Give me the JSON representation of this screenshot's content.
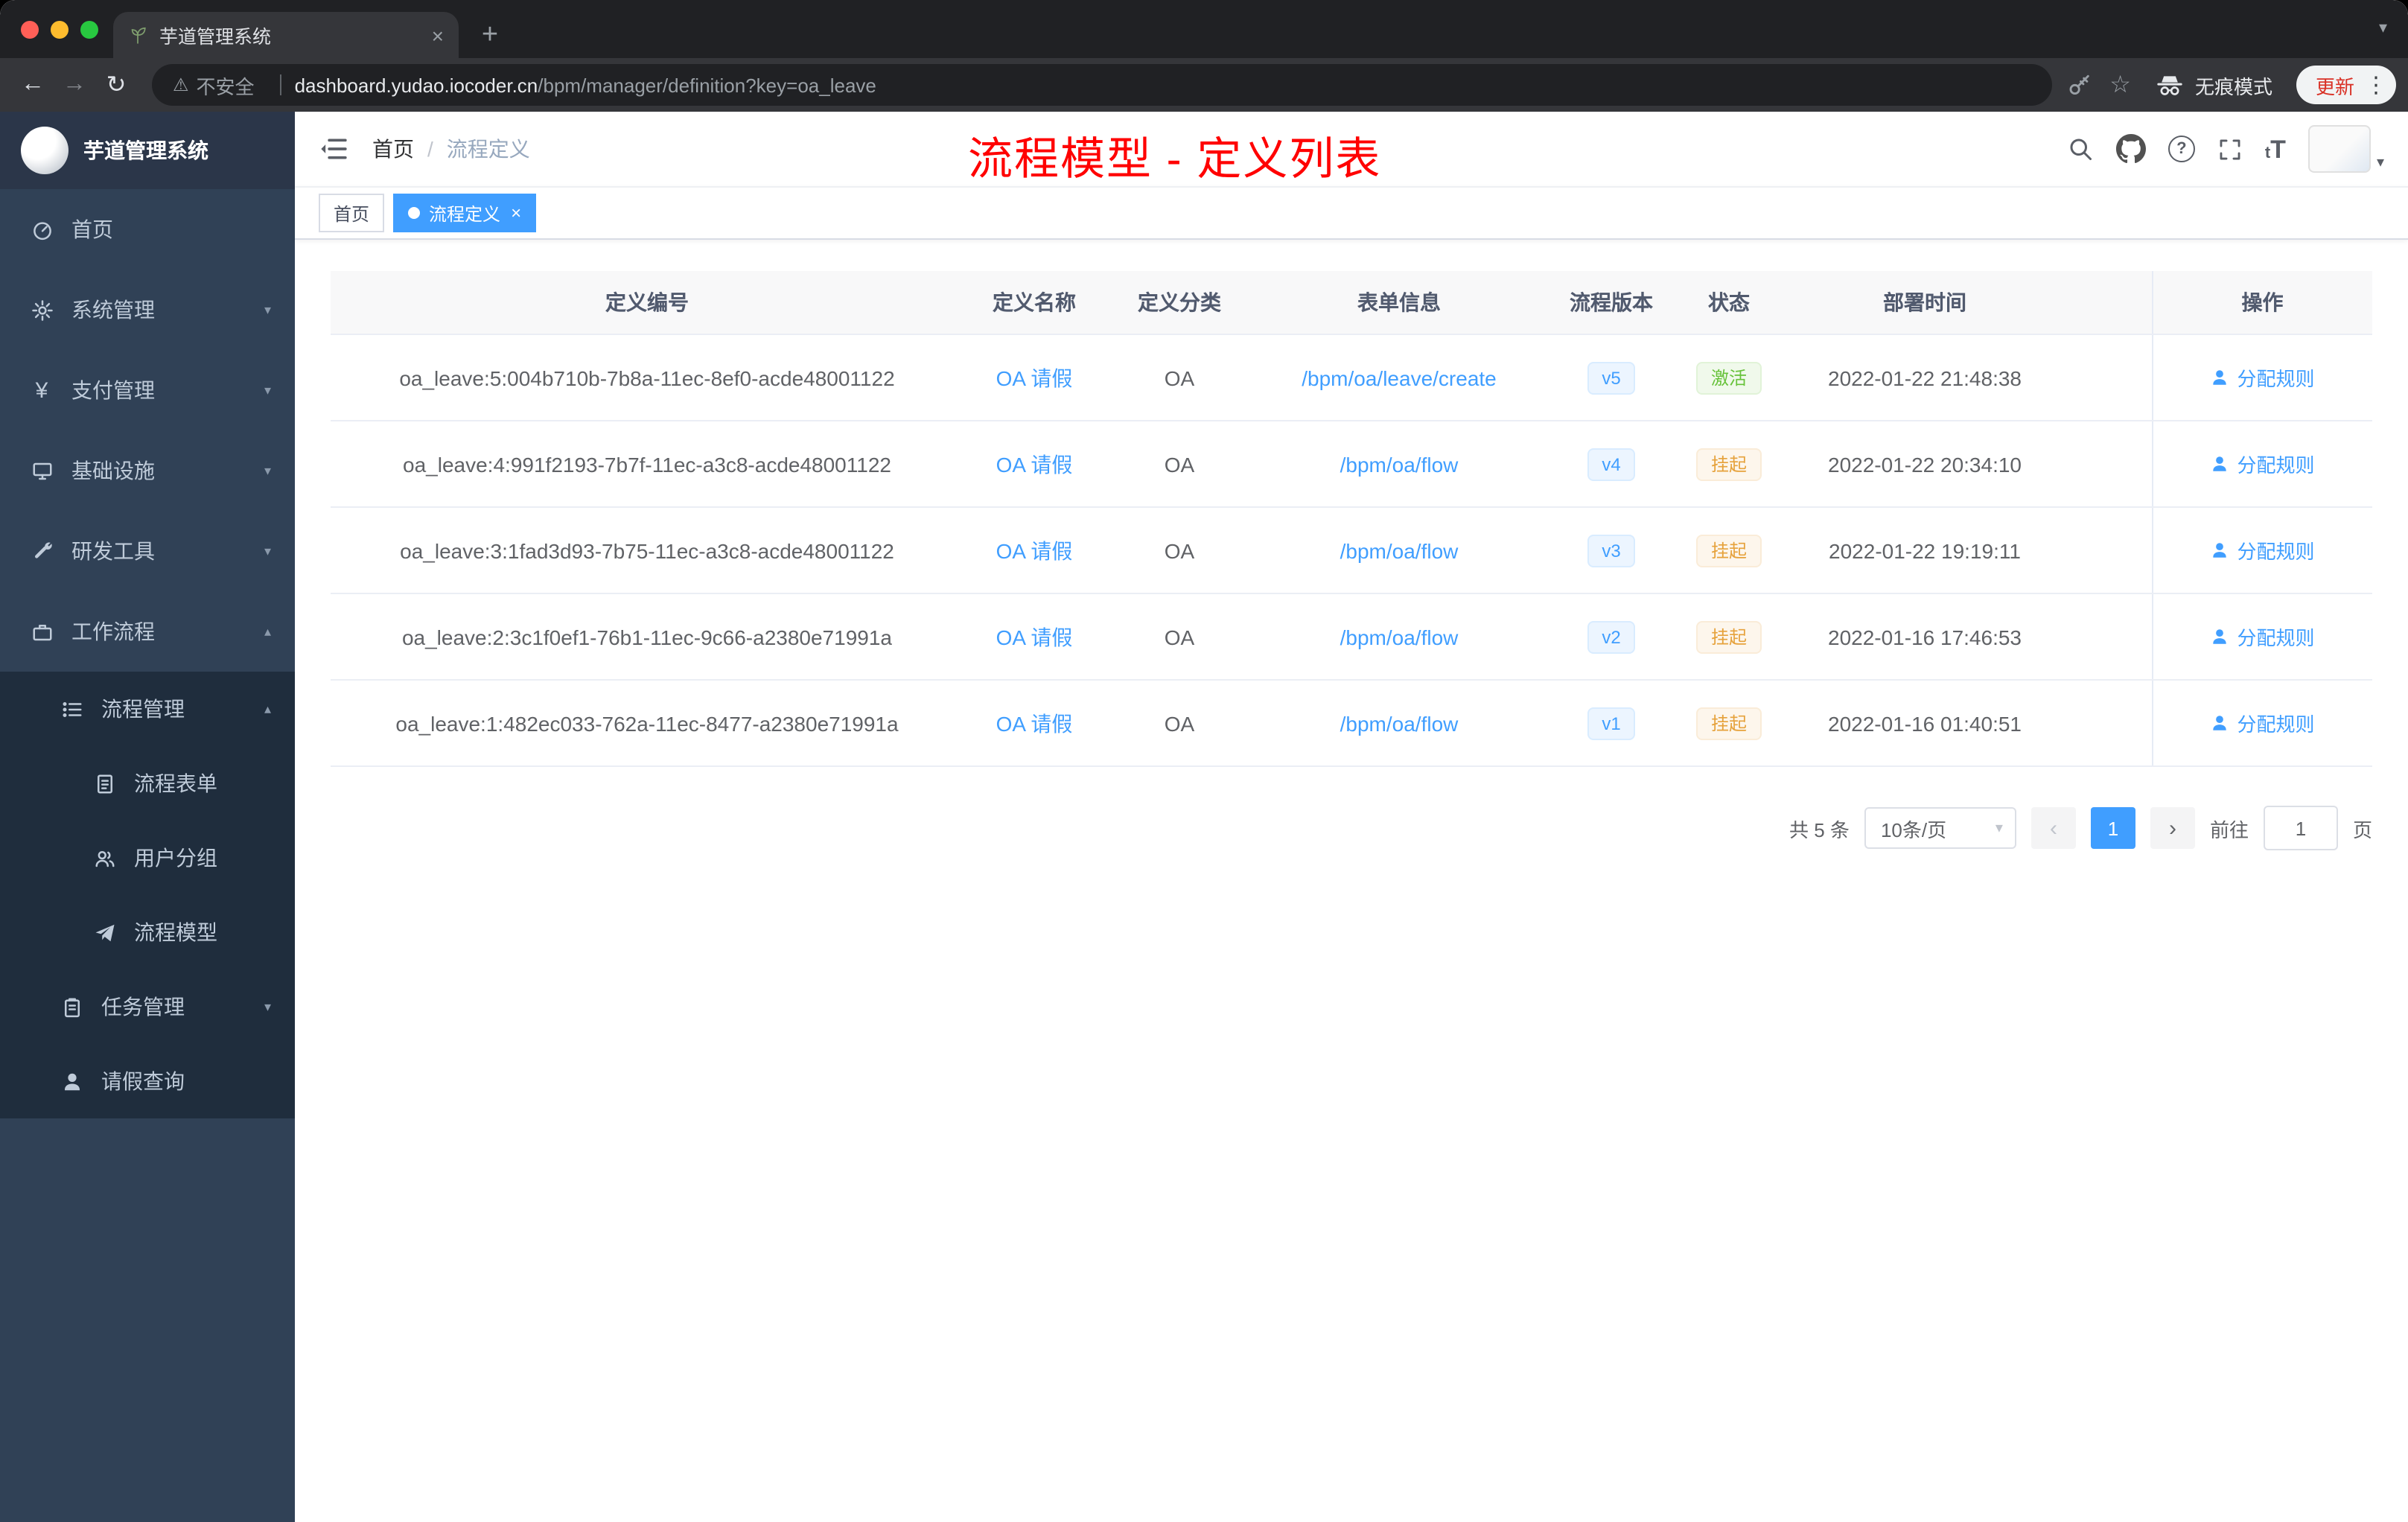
{
  "colors": {
    "accent": "#409eff",
    "success": "#67c23a",
    "warning": "#e6a23c",
    "annotation_red": "#ff0000",
    "sidebar_bg": "#304156",
    "submenu_bg": "#1f2d3d"
  },
  "browser": {
    "tab_title": "芋道管理系统",
    "security_label": "不安全",
    "url_domain": "dashboard.yudao.iocoder.cn",
    "url_path": "/bpm/manager/definition?key=oa_leave",
    "incognito_label": "无痕模式",
    "update_label": "更新"
  },
  "sidebar": {
    "logo_title": "芋道管理系统",
    "items": [
      {
        "label": "首页"
      },
      {
        "label": "系统管理"
      },
      {
        "label": "支付管理"
      },
      {
        "label": "基础设施"
      },
      {
        "label": "研发工具"
      },
      {
        "label": "工作流程"
      },
      {
        "label": "流程管理"
      },
      {
        "label": "流程表单"
      },
      {
        "label": "用户分组"
      },
      {
        "label": "流程模型"
      },
      {
        "label": "任务管理"
      },
      {
        "label": "请假查询"
      }
    ]
  },
  "header": {
    "breadcrumb_home": "首页",
    "breadcrumb_sep": "/",
    "breadcrumb_current": "流程定义",
    "annotation": "流程模型 - 定义列表"
  },
  "tags": {
    "home": "首页",
    "current": "流程定义"
  },
  "table": {
    "columns": [
      "定义编号",
      "定义名称",
      "定义分类",
      "表单信息",
      "流程版本",
      "状态",
      "部署时间",
      "操作"
    ],
    "rows": [
      {
        "id": "oa_leave:5:004b710b-7b8a-11ec-8ef0-acde48001122",
        "name": "OA 请假",
        "category": "OA",
        "form": "/bpm/oa/leave/create",
        "version": "v5",
        "status": "激活",
        "status_type": "success",
        "time": "2022-01-22 21:48:38",
        "action": "分配规则"
      },
      {
        "id": "oa_leave:4:991f2193-7b7f-11ec-a3c8-acde48001122",
        "name": "OA 请假",
        "category": "OA",
        "form": "/bpm/oa/flow",
        "version": "v4",
        "status": "挂起",
        "status_type": "warning",
        "time": "2022-01-22 20:34:10",
        "action": "分配规则"
      },
      {
        "id": "oa_leave:3:1fad3d93-7b75-11ec-a3c8-acde48001122",
        "name": "OA 请假",
        "category": "OA",
        "form": "/bpm/oa/flow",
        "version": "v3",
        "status": "挂起",
        "status_type": "warning",
        "time": "2022-01-22 19:19:11",
        "action": "分配规则"
      },
      {
        "id": "oa_leave:2:3c1f0ef1-76b1-11ec-9c66-a2380e71991a",
        "name": "OA 请假",
        "category": "OA",
        "form": "/bpm/oa/flow",
        "version": "v2",
        "status": "挂起",
        "status_type": "warning",
        "time": "2022-01-16 17:46:53",
        "action": "分配规则"
      },
      {
        "id": "oa_leave:1:482ec033-762a-11ec-8477-a2380e71991a",
        "name": "OA 请假",
        "category": "OA",
        "form": "/bpm/oa/flow",
        "version": "v1",
        "status": "挂起",
        "status_type": "warning",
        "time": "2022-01-16 01:40:51",
        "action": "分配规则"
      }
    ]
  },
  "pagination": {
    "total": "共 5 条",
    "page_size": "10条/页",
    "page": "1",
    "goto_label": "前往",
    "goto_value": "1",
    "page_unit": "页"
  }
}
